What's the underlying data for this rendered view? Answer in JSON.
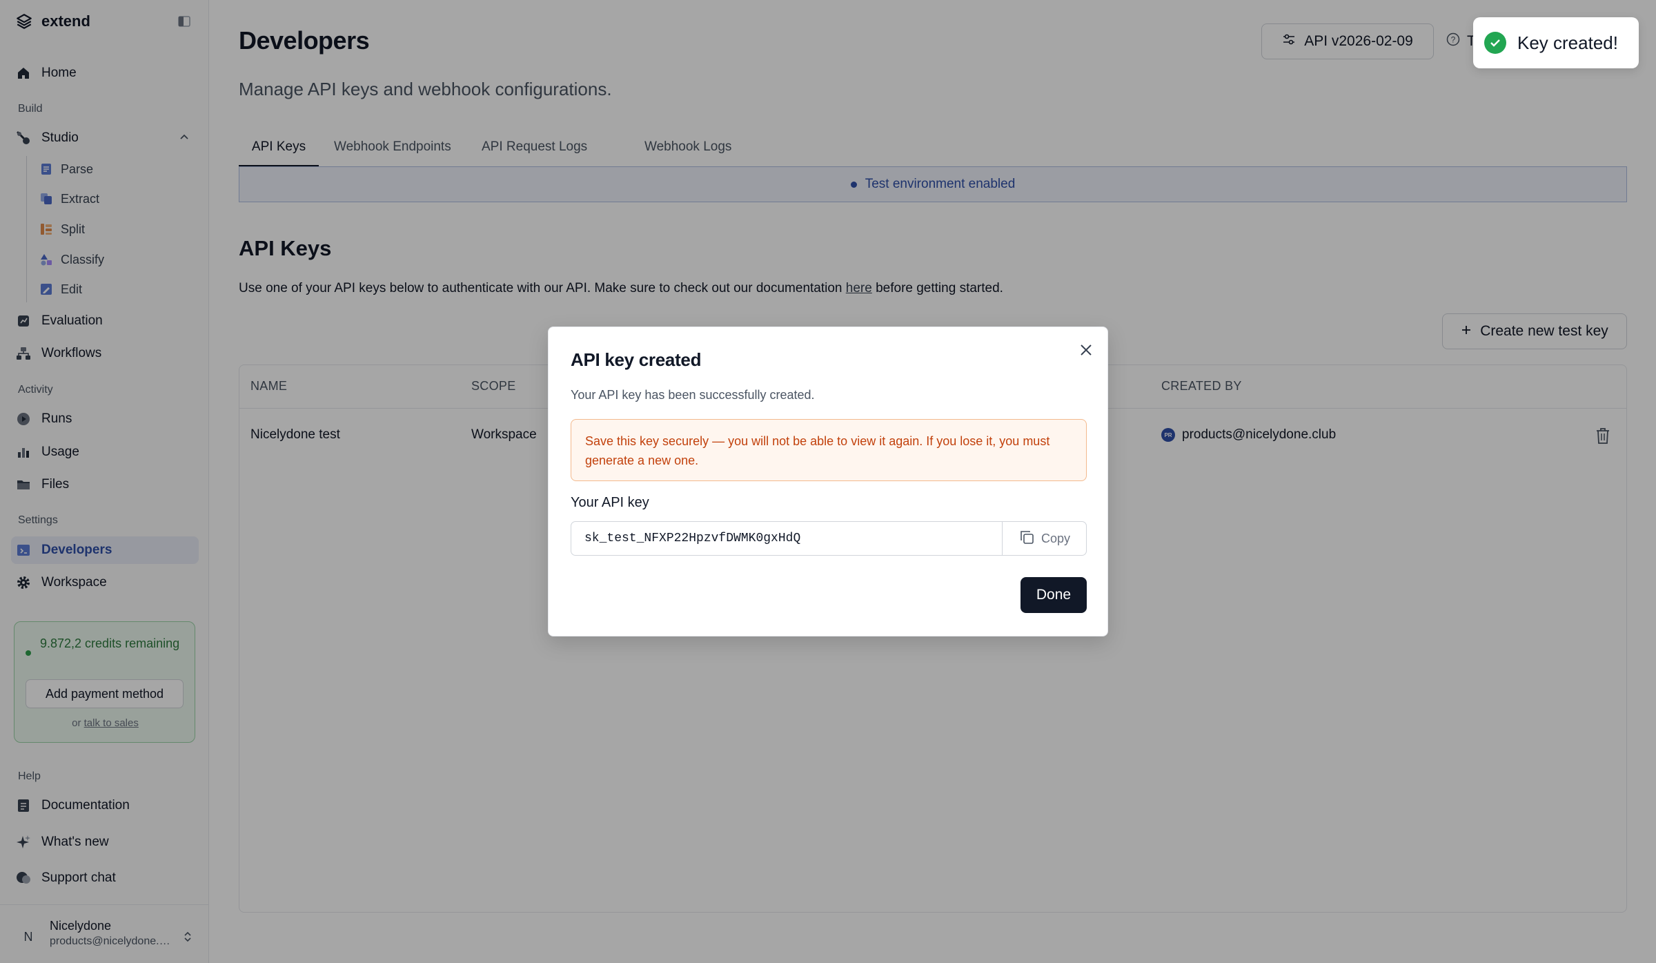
{
  "brand": {
    "name": "extend"
  },
  "sidebar": {
    "home": "Home",
    "sections": {
      "build": "Build",
      "activity": "Activity",
      "settings": "Settings",
      "help": "Help"
    },
    "studio": "Studio",
    "studio_items": [
      "Parse",
      "Extract",
      "Split",
      "Classify",
      "Edit"
    ],
    "evaluation": "Evaluation",
    "workflows": "Workflows",
    "runs": "Runs",
    "usage": "Usage",
    "files": "Files",
    "developers": "Developers",
    "workspace": "Workspace",
    "credits": {
      "text": "9.872,2 credits remaining",
      "pay_button": "Add payment method",
      "or": "or",
      "sales_link": "talk to sales"
    },
    "documentation": "Documentation",
    "whats_new": "What's new",
    "support_chat": "Support chat",
    "user": {
      "initial": "N",
      "name": "Nicelydone",
      "email": "products@nicelydone.club"
    }
  },
  "header": {
    "title": "Developers",
    "subtitle": "Manage API keys and webhook configurations.",
    "api_version": "API v2026-02-09",
    "help_partial": "T"
  },
  "tabs": [
    "API Keys",
    "Webhook Endpoints",
    "API Request Logs",
    "Webhook Logs"
  ],
  "banner": {
    "text": "Test environment enabled"
  },
  "api_keys": {
    "title": "API Keys",
    "desc_before": "Use one of your API keys below to authenticate with our API. Make sure to check out our documentation ",
    "desc_link": "here",
    "desc_after": " before getting started.",
    "create_button": "Create new test key",
    "columns": {
      "name": "NAME",
      "scope": "SCOPE",
      "created_by": "CREATED BY"
    },
    "rows": [
      {
        "name": "Nicelydone test",
        "scope": "Workspace",
        "created_by": "products@nicelydone.club",
        "avatar": "PR"
      }
    ]
  },
  "modal": {
    "title": "API key created",
    "subtitle": "Your API key has been successfully created.",
    "warning": "Save this key securely — you will not be able to view it again. If you lose it, you must generate a new one.",
    "key_label": "Your API key",
    "key_value": "sk_test_NFXP22HpzvfDWMK0gxHdQ",
    "copy_label": "Copy",
    "done_label": "Done"
  },
  "toast": {
    "text": "Key created!"
  },
  "colors": {
    "accent": "#2f4fa8",
    "success": "#22a652",
    "warning": "#c2410c",
    "primary_dark": "#111827"
  }
}
